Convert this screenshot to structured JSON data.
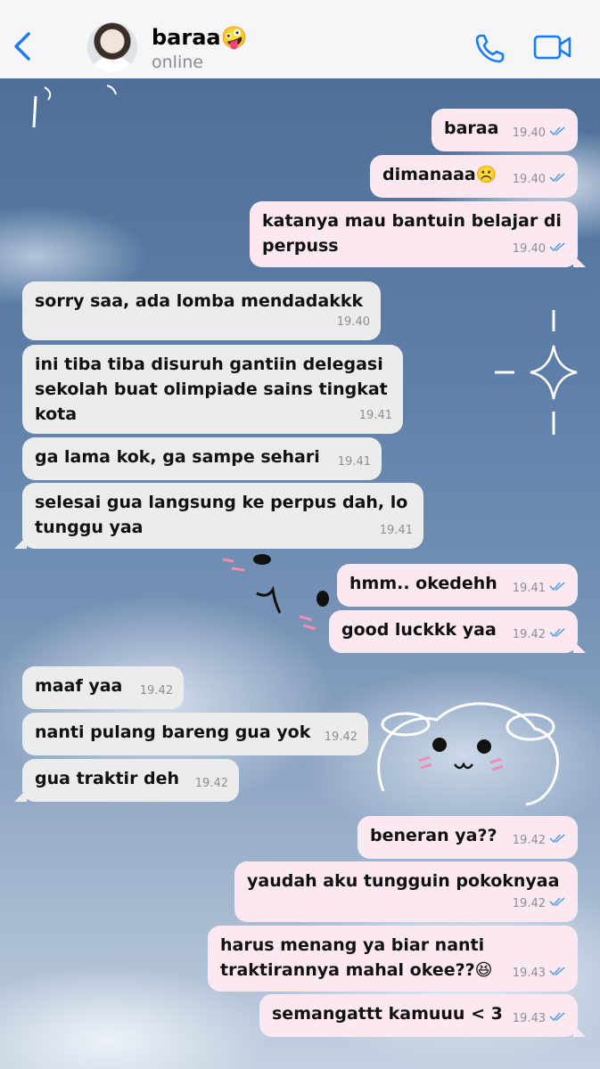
{
  "header": {
    "back_icon": "chevron-left-icon",
    "contact_name": "baraa🤪",
    "status": "online",
    "call_icon": "phone-icon",
    "video_icon": "video-camera-icon",
    "accent": "#1a7cf6"
  },
  "messages": [
    {
      "text": "baraa",
      "time": "19.40",
      "side": "out"
    },
    {
      "text": "dimanaaa☹️",
      "time": "19.40",
      "side": "out"
    },
    {
      "text": "katanya mau bantuin belajar di\nperpuss",
      "time": "19.40",
      "side": "out"
    },
    {
      "text": "sorry saa, ada lomba mendadakkk",
      "time": "19.40",
      "side": "in"
    },
    {
      "text": "ini tiba tiba disuruh gantiin delegasi\nsekolah buat olimpiade sains tingkat\nkota",
      "time": "19.41",
      "side": "in"
    },
    {
      "text": "ga lama kok, ga sampe sehari",
      "time": "19.41",
      "side": "in"
    },
    {
      "text": "selesai gua langsung ke perpus dah, lo\ntunggu yaa",
      "time": "19.41",
      "side": "in"
    },
    {
      "text": "hmm.. okedehh",
      "time": "19.41",
      "side": "out"
    },
    {
      "text": "good luckkk yaa",
      "time": "19.42",
      "side": "out"
    },
    {
      "text": "maaf yaa",
      "time": "19.42",
      "side": "in"
    },
    {
      "text": "nanti pulang bareng gua yok",
      "time": "19.42",
      "side": "in"
    },
    {
      "text": "gua traktir deh",
      "time": "19.42",
      "side": "in"
    },
    {
      "text": "beneran ya??",
      "time": "19.42",
      "side": "out"
    },
    {
      "text": "yaudah aku tungguin pokoknyaa",
      "time": "19.42",
      "side": "out"
    },
    {
      "text": "harus menang ya biar nanti\ntraktirannya mahal okee??😆",
      "time": "19.43",
      "side": "out"
    },
    {
      "text": "semangattt kamuuu < 3",
      "time": "19.43",
      "side": "out"
    }
  ],
  "colors": {
    "outgoing_bubble": "#fbe8f0",
    "incoming_bubble": "#ececed",
    "read_ticks": "#5aa2e8"
  }
}
